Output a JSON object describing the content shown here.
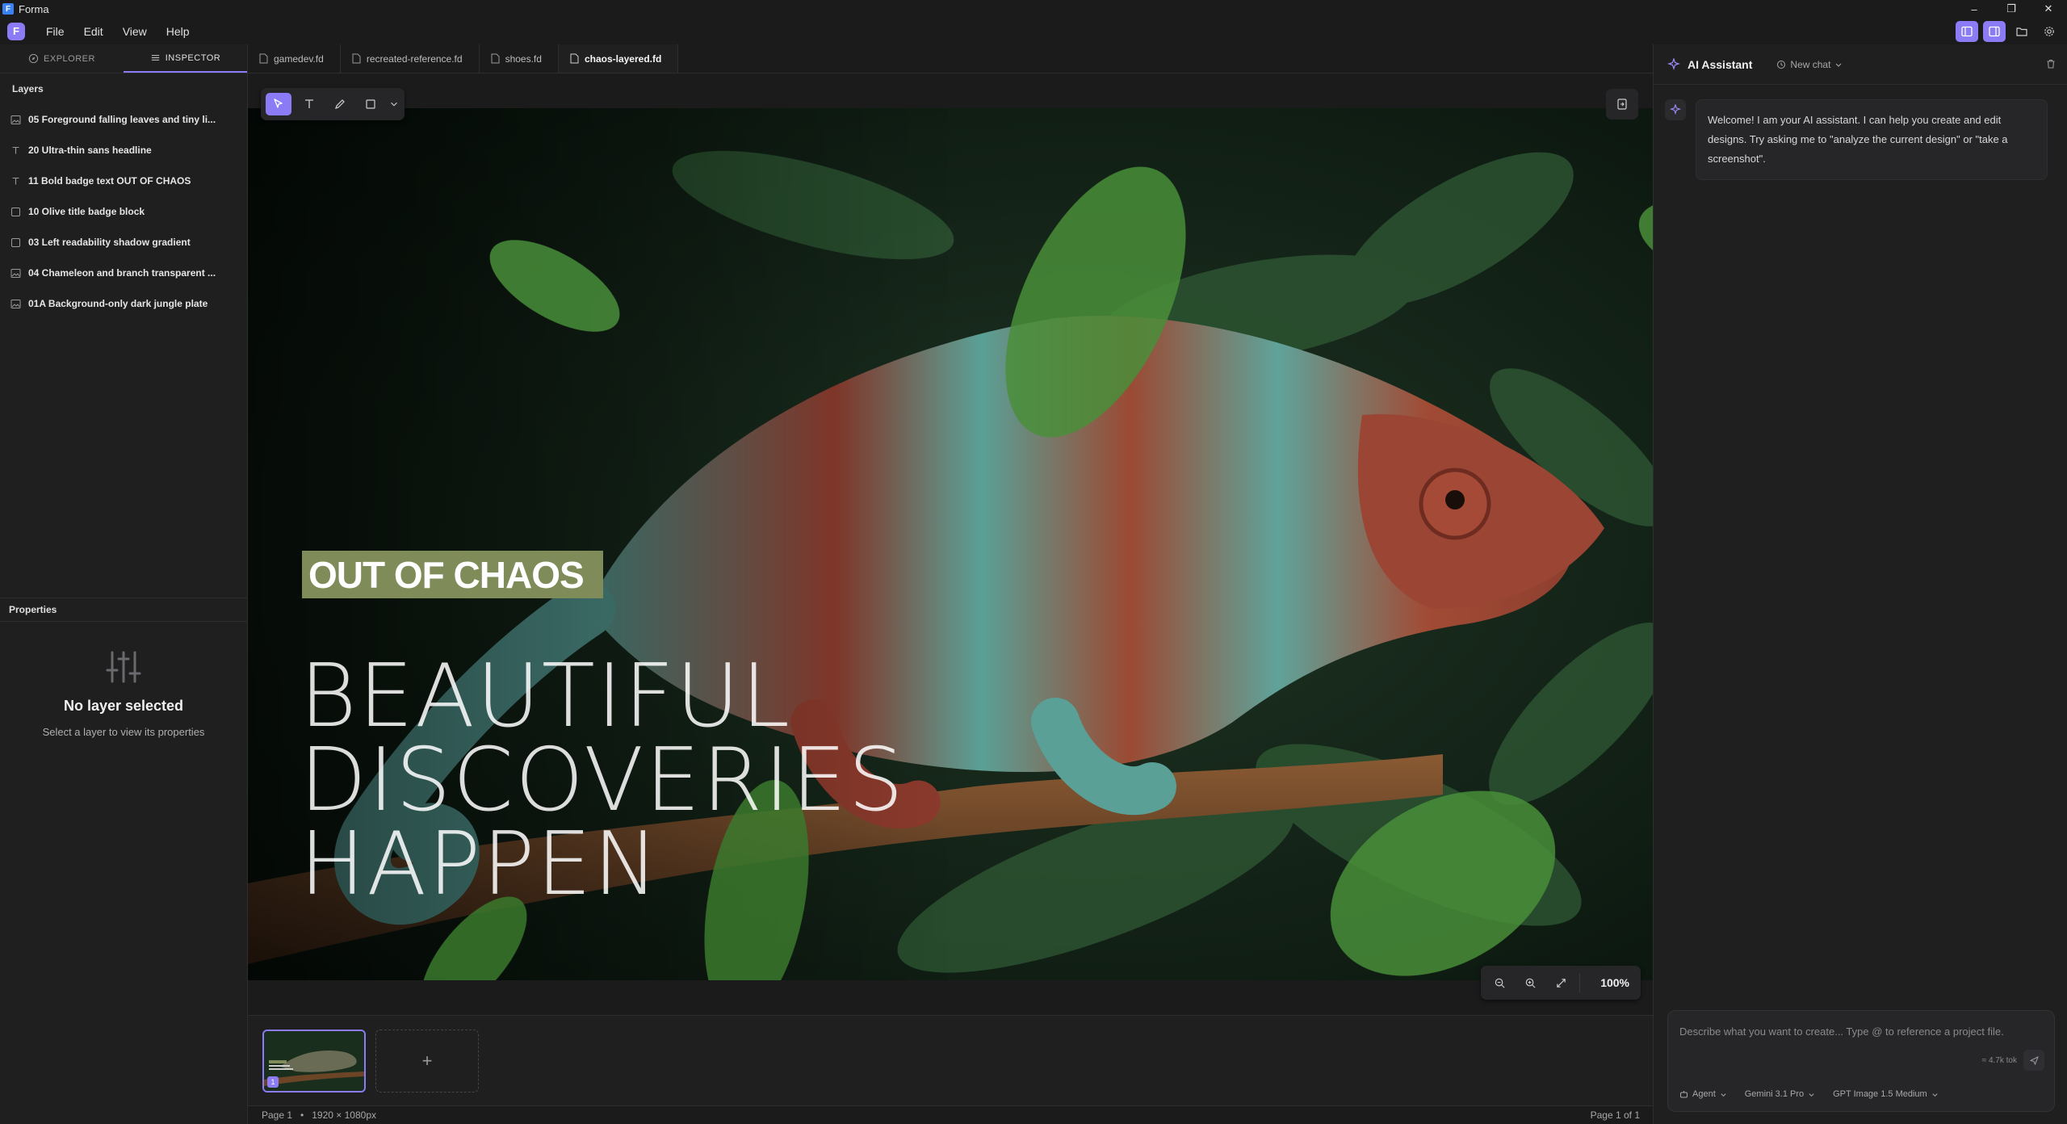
{
  "app": {
    "title": "Forma",
    "logo_letter": "F"
  },
  "window_controls": {
    "minimize": "–",
    "maximize": "❐",
    "close": "✕"
  },
  "menu": {
    "items": [
      "File",
      "Edit",
      "View",
      "Help"
    ]
  },
  "left_panel": {
    "tabs": [
      {
        "label": "EXPLORER"
      },
      {
        "label": "INSPECTOR"
      }
    ],
    "layers_title": "Layers",
    "layers": [
      {
        "label": "05 Foreground falling leaves and tiny li...",
        "icon": "image-icon"
      },
      {
        "label": "20 Ultra-thin sans headline",
        "icon": "text-icon"
      },
      {
        "label": "11 Bold badge text OUT OF CHAOS",
        "icon": "text-icon"
      },
      {
        "label": "10 Olive title badge block",
        "icon": "rectangle-icon"
      },
      {
        "label": "03 Left readability shadow gradient",
        "icon": "rectangle-icon"
      },
      {
        "label": "04 Chameleon and branch transparent ...",
        "icon": "image-icon"
      },
      {
        "label": "01A Background-only dark jungle plate",
        "icon": "image-icon"
      }
    ],
    "properties_title": "Properties",
    "empty_title": "No layer selected",
    "empty_subtitle": "Select a layer to view its properties"
  },
  "doc_tabs": [
    {
      "label": "gamedev.fd"
    },
    {
      "label": "recreated-reference.fd"
    },
    {
      "label": "shoes.fd"
    },
    {
      "label": "chaos-layered.fd"
    }
  ],
  "canvas": {
    "badge_text": "OUT OF CHAOS",
    "headline": [
      "BEAUTIFUL",
      "DISCOVERIES",
      "HAPPEN"
    ],
    "badge_color": "#7f8b58",
    "zoom": "100%"
  },
  "pages": {
    "page_number": "1",
    "add_label": "+"
  },
  "status": {
    "page": "Page 1",
    "separator": "•",
    "size": "1920 × 1080px",
    "page_count": "Page 1 of 1"
  },
  "assistant": {
    "title": "AI Assistant",
    "new_chat": "New chat",
    "welcome": "Welcome! I am your AI assistant. I can help you create and edit designs. Try asking me to \"analyze the current design\" or \"take a screenshot\".",
    "placeholder": "Describe what you want to create... Type @ to reference a project file.",
    "tokens": "≈ 4.7k tok",
    "mode": "Agent",
    "model": "Gemini 3.1 Pro",
    "image_model": "GPT Image 1.5 Medium"
  },
  "colors": {
    "accent": "#8b7cf6",
    "panel": "#1f1f20",
    "background": "#1b1b1c"
  }
}
